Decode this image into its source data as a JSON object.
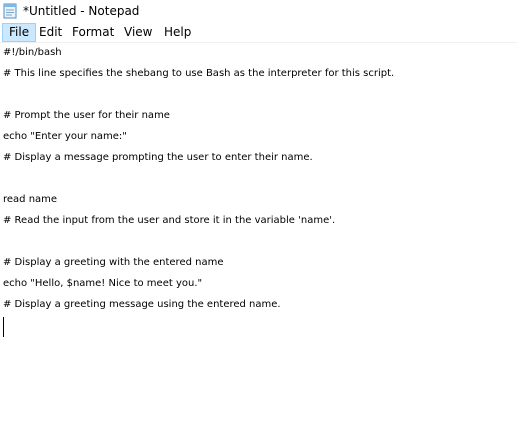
{
  "window": {
    "title": "*Untitled - Notepad",
    "app_icon": "notepad-icon"
  },
  "menu": {
    "items": [
      {
        "label": "File",
        "active": true
      },
      {
        "label": "Edit",
        "active": false
      },
      {
        "label": "Format",
        "active": false
      },
      {
        "label": "View",
        "active": false
      },
      {
        "label": "Help",
        "active": false
      }
    ]
  },
  "editor": {
    "lines": [
      "#!/bin/bash",
      "# This line specifies the shebang to use Bash as the interpreter for this script.",
      "",
      "# Prompt the user for their name",
      "echo \"Enter your name:\"",
      "# Display a message prompting the user to enter their name.",
      "",
      "read name",
      "# Read the input from the user and store it in the variable 'name'.",
      "",
      "# Display a greeting with the entered name",
      "echo \"Hello, $name! Nice to meet you.\"",
      "# Display a greeting message using the entered name.",
      ""
    ]
  },
  "colors": {
    "menu_active_bg": "#cce8ff",
    "menu_active_border": "#99d1ff",
    "background": "#ffffff",
    "text": "#000000"
  }
}
